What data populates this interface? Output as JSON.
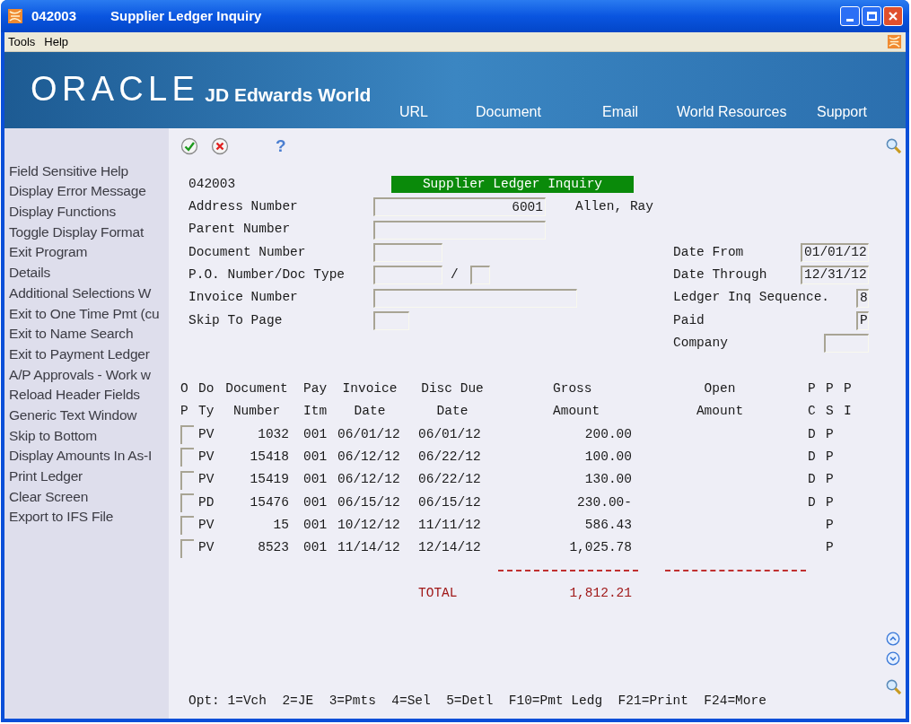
{
  "window": {
    "code": "042003",
    "title": "Supplier Ledger Inquiry"
  },
  "menu": [
    "Tools",
    "Help"
  ],
  "banner": {
    "logo": "ORACLE",
    "product": "JD Edwards World",
    "links": [
      "URL",
      "Document",
      "Email",
      "World Resources",
      "Support"
    ]
  },
  "toolbar": {
    "help": "?"
  },
  "sidebar": {
    "items": [
      "Field Sensitive Help",
      "Display Error Message",
      "Display Functions",
      "Toggle Display Format",
      "Exit Program",
      "Details",
      "Additional Selections W",
      "Exit to One Time Pmt (cu",
      "Exit to Name Search",
      "Exit to Payment Ledger",
      "A/P Approvals - Work w",
      "Reload Header Fields",
      "Generic Text Window",
      "Skip to Bottom",
      "Display Amounts In As-I",
      "Print Ledger",
      "Clear Screen",
      "Export to IFS File"
    ]
  },
  "form": {
    "program_id": "042003",
    "title": "Supplier Ledger Inquiry",
    "fields": [
      {
        "label": "Address Number",
        "value": "6001",
        "description": "Allen, Ray"
      },
      {
        "label": "Parent Number"
      },
      {
        "label": "Document Number"
      },
      {
        "label": "P.O. Number/Doc Type",
        "separator": "/"
      },
      {
        "label": "Invoice Number"
      },
      {
        "label": "Skip To Page"
      }
    ],
    "filters": [
      {
        "label": "Date From",
        "value": "01/01/12"
      },
      {
        "label": "Date Through",
        "value": "12/31/12"
      },
      {
        "label": "Ledger Inq Sequence.",
        "value": "8"
      },
      {
        "label": "Paid",
        "value": "P"
      },
      {
        "label": "Company"
      }
    ]
  },
  "table": {
    "columns": [
      [
        "O",
        "P"
      ],
      [
        "Do",
        "Ty"
      ],
      [
        "Document",
        "Number"
      ],
      [
        "Pay",
        "Itm"
      ],
      [
        "Invoice",
        "Date"
      ],
      [
        "Disc Due",
        "Date"
      ],
      [
        "Gross",
        "Amount"
      ],
      [
        "Open",
        "Amount"
      ],
      [
        "P",
        "C"
      ],
      [
        "P",
        "S"
      ],
      [
        "P",
        "I"
      ]
    ],
    "rows": [
      {
        "doc_type": "PV",
        "document_number": "1032",
        "pay_item": "001",
        "invoice_date": "06/01/12",
        "disc_due_date": "06/01/12",
        "gross_amount": "200.00",
        "pc": "D",
        "ps": "P"
      },
      {
        "doc_type": "PV",
        "document_number": "15418",
        "pay_item": "001",
        "invoice_date": "06/12/12",
        "disc_due_date": "06/22/12",
        "gross_amount": "100.00",
        "pc": "D",
        "ps": "P"
      },
      {
        "doc_type": "PV",
        "document_number": "15419",
        "pay_item": "001",
        "invoice_date": "06/12/12",
        "disc_due_date": "06/22/12",
        "gross_amount": "130.00",
        "pc": "D",
        "ps": "P"
      },
      {
        "doc_type": "PD",
        "document_number": "15476",
        "pay_item": "001",
        "invoice_date": "06/15/12",
        "disc_due_date": "06/15/12",
        "gross_amount": "230.00-",
        "pc": "D",
        "ps": "P"
      },
      {
        "doc_type": "PV",
        "document_number": "15",
        "pay_item": "001",
        "invoice_date": "10/12/12",
        "disc_due_date": "11/11/12",
        "gross_amount": "586.43",
        "ps": "P"
      },
      {
        "doc_type": "PV",
        "document_number": "8523",
        "pay_item": "001",
        "invoice_date": "11/14/12",
        "disc_due_date": "12/14/12",
        "gross_amount": "1,025.78",
        "ps": "P"
      }
    ],
    "total": {
      "label": "TOTAL",
      "gross_amount": "1,812.21"
    }
  },
  "options_line": "Opt: 1=Vch  2=JE  3=Pmts  4=Sel  5=Detl  F10=Pmt Ledg  F21=Print  F24=More"
}
